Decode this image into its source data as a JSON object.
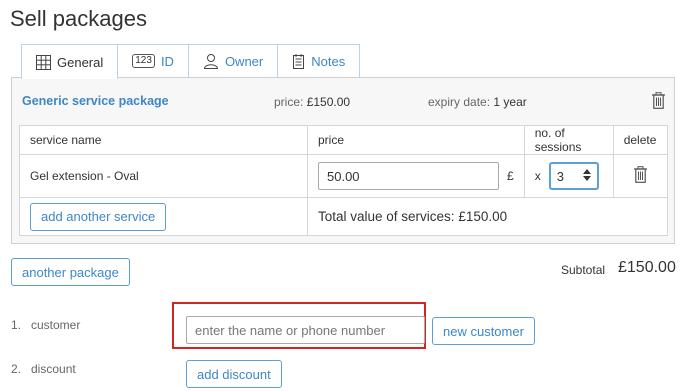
{
  "page_title": "Sell packages",
  "tabs": [
    {
      "label": "General",
      "icon": "grid-icon",
      "active": true
    },
    {
      "label": "ID",
      "badge": "123",
      "icon": "id-card-icon",
      "active": false
    },
    {
      "label": "Owner",
      "icon": "user-icon",
      "active": false
    },
    {
      "label": "Notes",
      "icon": "notes-icon",
      "active": false
    }
  ],
  "package": {
    "name": "Generic service package",
    "price_label": "price:",
    "price_value": "£150.00",
    "expiry_label": "expiry date:",
    "expiry_value": "1 year"
  },
  "table": {
    "headers": {
      "service": "service name",
      "price": "price",
      "sessions": "no. of sessions",
      "delete": "delete"
    },
    "rows": [
      {
        "service": "Gel extension - Oval",
        "price": "50.00",
        "currency": "£",
        "times": "x",
        "sessions": "3"
      }
    ],
    "add_service_label": "add another service",
    "total_label": "Total value of services: £150.00"
  },
  "another_package_label": "another package",
  "subtotal": {
    "label": "Subtotal",
    "value": "£150.00"
  },
  "steps": [
    {
      "num": "1.",
      "label": "customer"
    },
    {
      "num": "2.",
      "label": "discount"
    }
  ],
  "customer": {
    "placeholder": "enter the name or phone number",
    "new_customer_label": "new customer"
  },
  "discount": {
    "add_label": "add discount"
  },
  "colors": {
    "accent": "#3d87c7",
    "highlight": "#d32424",
    "panel_bg": "#f7f7f7"
  }
}
